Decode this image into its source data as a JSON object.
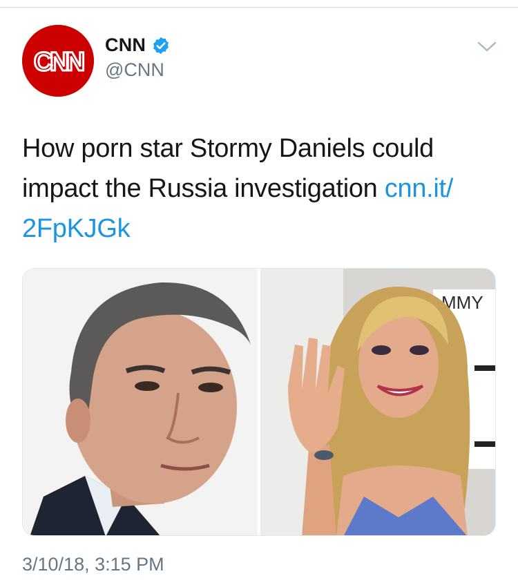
{
  "tweet": {
    "avatar_label": "CNN",
    "display_name": "CNN",
    "handle": "@CNN",
    "text_before_link": "How porn star Stormy Daniels could impact the Russia investigation ",
    "link_line1": "cnn.it/",
    "link_line2": "2FpKJGk",
    "timestamp": "3/10/18, 3:15 PM",
    "photo_sign_text": "MMY"
  },
  "icons": {
    "verified": "verified-badge-icon",
    "menu": "chevron-down-icon"
  },
  "colors": {
    "brand_red": "#cc0000",
    "verified_blue": "#1da1f2",
    "link_blue": "#1b95e0",
    "secondary_text": "#657786"
  }
}
